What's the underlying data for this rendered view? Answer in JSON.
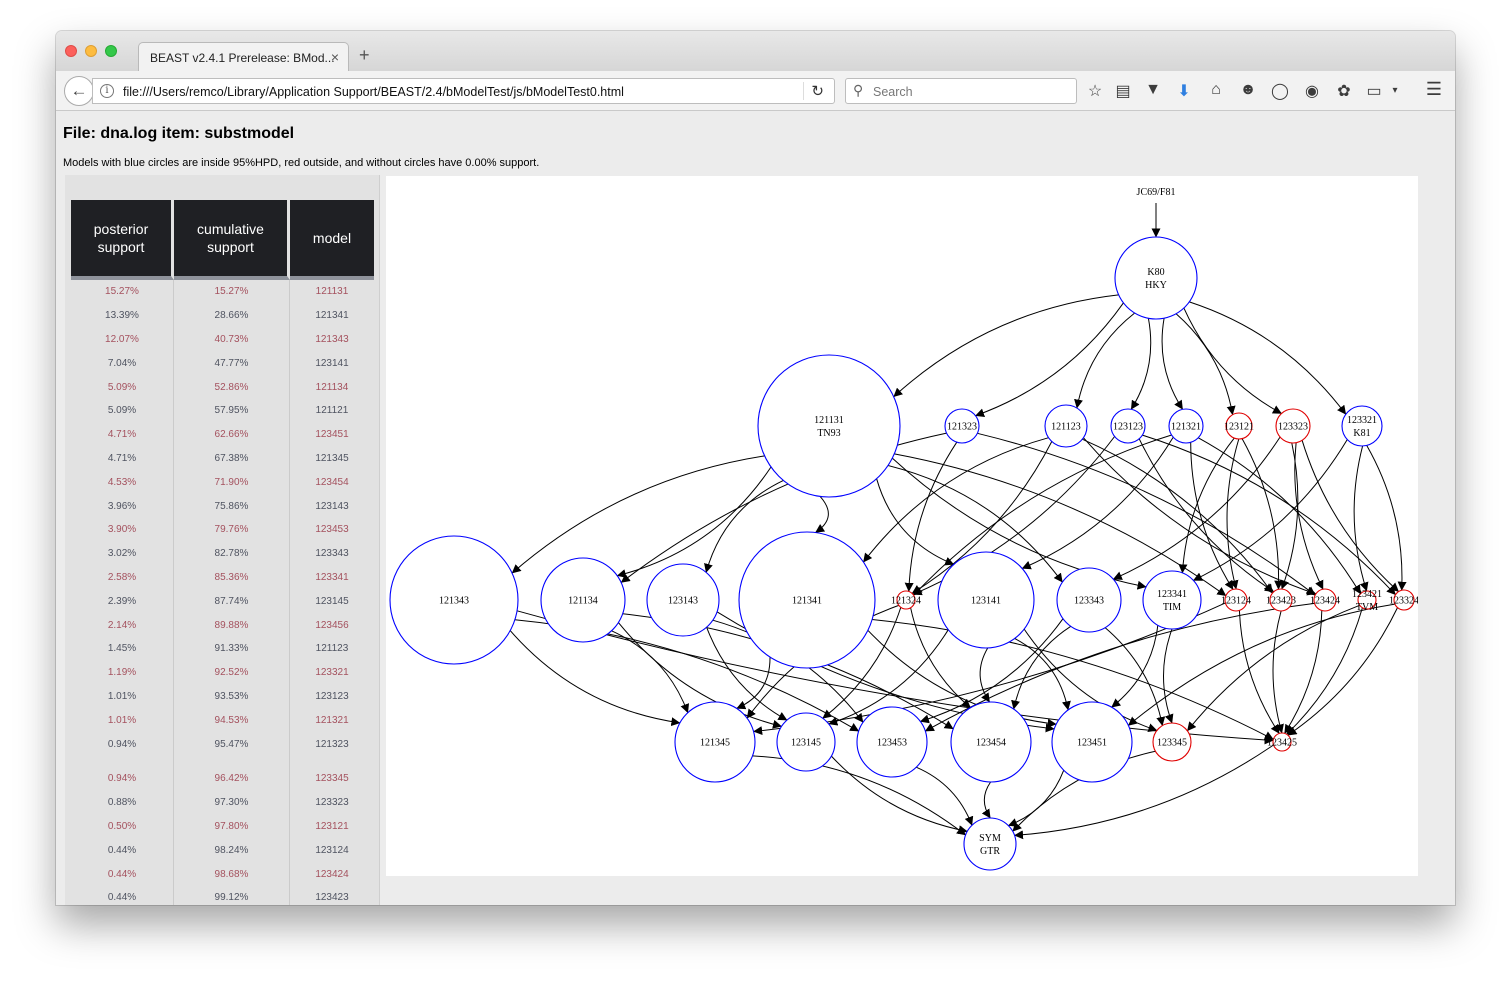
{
  "browser": {
    "tab_title": "BEAST v2.4.1 Prerelease: BMod...",
    "tab_close": "×",
    "new_tab": "+",
    "url": "file:///Users/remco/Library/Application Support/BEAST/2.4/bModelTest/js/bModelTest0.html",
    "search_placeholder": "Search"
  },
  "page": {
    "title": "File: dna.log item: substmodel",
    "subtitle": "Models with blue circles are inside 95%HPD, red outside, and without circles have 0.00% support."
  },
  "table": {
    "headers": [
      "posterior support",
      "cumulative support",
      "model"
    ],
    "rows": [
      [
        "15.27%",
        "15.27%",
        "121131"
      ],
      [
        "13.39%",
        "28.66%",
        "121341"
      ],
      [
        "12.07%",
        "40.73%",
        "121343"
      ],
      [
        "7.04%",
        "47.77%",
        "123141"
      ],
      [
        "5.09%",
        "52.86%",
        "121134"
      ],
      [
        "5.09%",
        "57.95%",
        "121121"
      ],
      [
        "4.71%",
        "62.66%",
        "123451"
      ],
      [
        "4.71%",
        "67.38%",
        "121345"
      ],
      [
        "4.53%",
        "71.90%",
        "123454"
      ],
      [
        "3.96%",
        "75.86%",
        "123143"
      ],
      [
        "3.90%",
        "79.76%",
        "123453"
      ],
      [
        "3.02%",
        "82.78%",
        "123343"
      ],
      [
        "2.58%",
        "85.36%",
        "123341"
      ],
      [
        "2.39%",
        "87.74%",
        "123145"
      ],
      [
        "2.14%",
        "89.88%",
        "123456"
      ],
      [
        "1.45%",
        "91.33%",
        "121123"
      ],
      [
        "1.19%",
        "92.52%",
        "123321"
      ],
      [
        "1.01%",
        "93.53%",
        "123123"
      ],
      [
        "1.01%",
        "94.53%",
        "121321"
      ],
      [
        "0.94%",
        "95.47%",
        "121323"
      ],
      [
        "0.94%",
        "96.42%",
        "123345"
      ],
      [
        "0.88%",
        "97.30%",
        "123323"
      ],
      [
        "0.50%",
        "97.80%",
        "123121"
      ],
      [
        "0.44%",
        "98.24%",
        "123124"
      ],
      [
        "0.44%",
        "98.68%",
        "123424"
      ],
      [
        "0.44%",
        "99.12%",
        "123423"
      ]
    ]
  },
  "graph": {
    "colors": {
      "inside": "#0000ff",
      "outside": "#e00000",
      "edge": "#000000"
    },
    "top_label": "JC69/F81",
    "nodes": [
      {
        "id": "K80",
        "label": [
          "K80",
          "HKY"
        ],
        "status": "inside"
      },
      {
        "id": "121131",
        "label": [
          "121131",
          "TN93"
        ],
        "status": "inside"
      },
      {
        "id": "121323",
        "label": [
          "121323"
        ],
        "status": "inside"
      },
      {
        "id": "121123",
        "label": [
          "121123"
        ],
        "status": "inside"
      },
      {
        "id": "123123",
        "label": [
          "123123"
        ],
        "status": "inside"
      },
      {
        "id": "121321",
        "label": [
          "121321"
        ],
        "status": "inside"
      },
      {
        "id": "123121",
        "label": [
          "123121"
        ],
        "status": "outside"
      },
      {
        "id": "123323",
        "label": [
          "123323"
        ],
        "status": "outside"
      },
      {
        "id": "123321",
        "label": [
          "123321",
          "K81"
        ],
        "status": "inside"
      },
      {
        "id": "121343",
        "label": [
          "121343"
        ],
        "status": "inside"
      },
      {
        "id": "121134",
        "label": [
          "121134"
        ],
        "status": "inside"
      },
      {
        "id": "123143",
        "label": [
          "123143"
        ],
        "status": "inside"
      },
      {
        "id": "121341",
        "label": [
          "121341"
        ],
        "status": "inside"
      },
      {
        "id": "121324",
        "label": [
          "121324"
        ],
        "status": "outside"
      },
      {
        "id": "123141",
        "label": [
          "123141"
        ],
        "status": "inside"
      },
      {
        "id": "123343",
        "label": [
          "123343"
        ],
        "status": "inside"
      },
      {
        "id": "123341",
        "label": [
          "123341",
          "TIM"
        ],
        "status": "inside"
      },
      {
        "id": "123124",
        "label": [
          "123124"
        ],
        "status": "outside"
      },
      {
        "id": "123423",
        "label": [
          "123423"
        ],
        "status": "outside"
      },
      {
        "id": "123424",
        "label": [
          "123424"
        ],
        "status": "outside"
      },
      {
        "id": "123421",
        "label": [
          "123421",
          "TVM"
        ],
        "status": "outside"
      },
      {
        "id": "123324",
        "label": [
          "123324"
        ],
        "status": "outside"
      },
      {
        "id": "121345",
        "label": [
          "121345"
        ],
        "status": "inside"
      },
      {
        "id": "123145",
        "label": [
          "123145"
        ],
        "status": "inside"
      },
      {
        "id": "123453",
        "label": [
          "123453"
        ],
        "status": "inside"
      },
      {
        "id": "123454",
        "label": [
          "123454"
        ],
        "status": "inside"
      },
      {
        "id": "123451",
        "label": [
          "123451"
        ],
        "status": "inside"
      },
      {
        "id": "123345",
        "label": [
          "123345"
        ],
        "status": "outside"
      },
      {
        "id": "123425",
        "label": [
          "123425"
        ],
        "status": "outside"
      },
      {
        "id": "SYM",
        "label": [
          "SYM",
          "GTR"
        ],
        "status": "inside"
      }
    ]
  }
}
